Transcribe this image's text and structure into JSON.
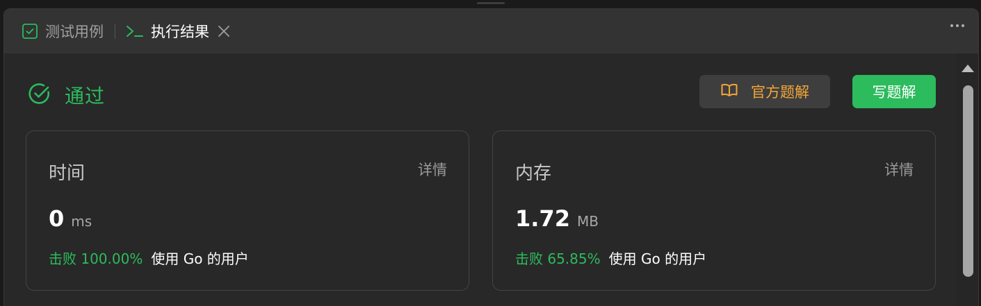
{
  "tabs": {
    "testcase_label": "测试用例",
    "result_label": "执行结果"
  },
  "result": {
    "status": "通过",
    "official_solution_label": "官方题解",
    "write_solution_label": "写题解"
  },
  "time_card": {
    "title": "时间",
    "detail_label": "详情",
    "value": "0",
    "unit": "ms",
    "beat_text": "击败 100.00%",
    "beat_suffix": "使用 Go 的用户"
  },
  "memory_card": {
    "title": "内存",
    "detail_label": "详情",
    "value": "1.72",
    "unit": "MB",
    "beat_text": "击败 65.85%",
    "beat_suffix": "使用 Go 的用户"
  },
  "colors": {
    "accent_green": "#2cbb5d",
    "accent_orange": "#f3a638",
    "panel_bg": "#282828",
    "tabbar_bg": "#333333"
  },
  "icons": {
    "testcase": "checkbox-icon",
    "result": "terminal-icon",
    "status": "check-circle-icon",
    "official": "book-icon",
    "menu": "more-dots-icon"
  }
}
